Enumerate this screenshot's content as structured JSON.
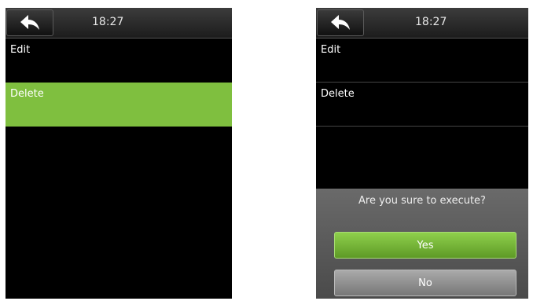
{
  "left_screen": {
    "header": {
      "time": "18:27"
    },
    "menu": [
      {
        "label": "Edit"
      },
      {
        "label": "Delete"
      }
    ]
  },
  "right_screen": {
    "header": {
      "time": "18:27"
    },
    "menu": [
      {
        "label": "Edit"
      },
      {
        "label": "Delete"
      }
    ],
    "dialog": {
      "title": "Are you sure to execute?",
      "yes_label": "Yes",
      "no_label": "No"
    }
  },
  "icons": {
    "back": "back-arrow-icon"
  },
  "colors": {
    "selected": "#7fbf3f",
    "yes_button": "#6fae32",
    "no_button": "#8f8f8f"
  }
}
